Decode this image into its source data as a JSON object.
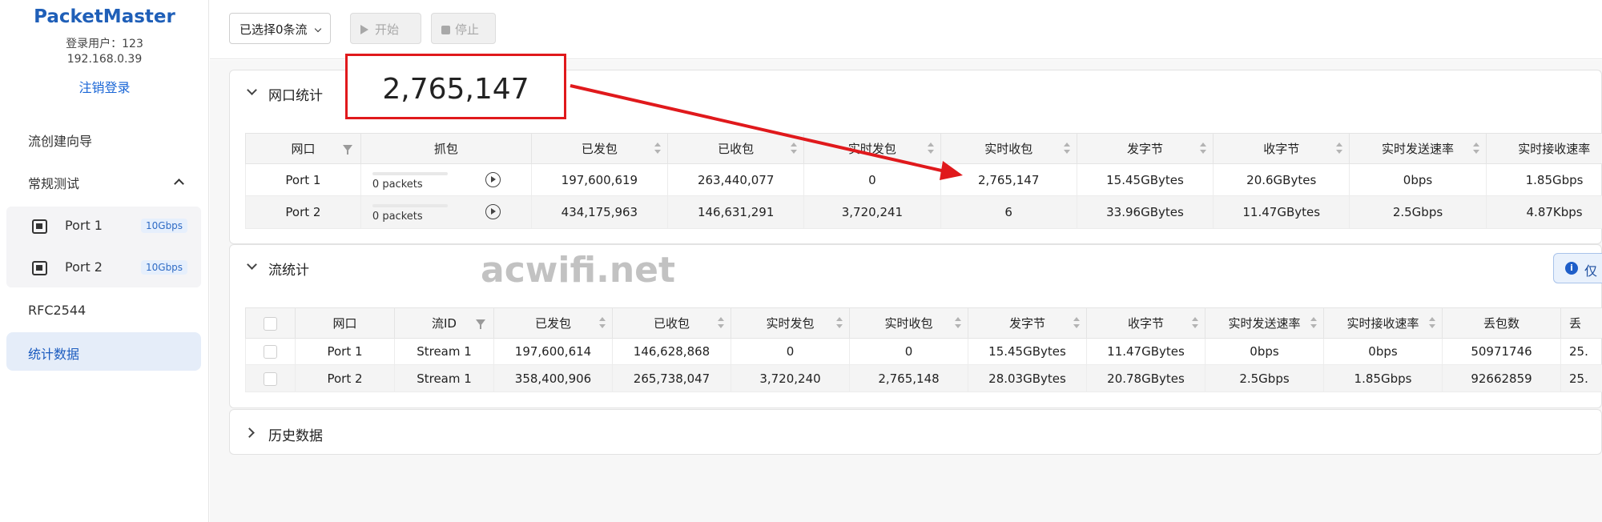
{
  "sidebar": {
    "brand": "PacketMaster",
    "user": "登录用户：123",
    "ip": "192.168.0.39",
    "logout": "注销登录",
    "items": [
      {
        "label": "流创建向导"
      },
      {
        "label": "常规测试"
      },
      {
        "label": "RFC2544"
      },
      {
        "label": "统计数据"
      }
    ],
    "ports": [
      {
        "label": "Port 1",
        "speed": "10Gbps"
      },
      {
        "label": "Port 2",
        "speed": "10Gbps"
      }
    ]
  },
  "toolbar": {
    "selector": "已选择0条流",
    "start": "开始",
    "stop": "停止"
  },
  "port_stats": {
    "title": "网口统计",
    "headers": [
      "网口",
      "抓包",
      "已发包",
      "已收包",
      "实时发包",
      "实时收包",
      "发字节",
      "收字节",
      "实时发送速率",
      "实时接收速率"
    ],
    "rows": [
      {
        "port": "Port 1",
        "capture": "0 packets",
        "sent": "197,600,619",
        "received": "263,440,077",
        "rt_sent": "0",
        "rt_recv": "2,765,147",
        "bytes_sent": "15.45GBytes",
        "bytes_recv": "20.6GBytes",
        "rate_tx": "0bps",
        "rate_rx": "1.85Gbps"
      },
      {
        "port": "Port 2",
        "capture": "0 packets",
        "sent": "434,175,963",
        "received": "146,631,291",
        "rt_sent": "3,720,241",
        "rt_recv": "6",
        "bytes_sent": "33.96GBytes",
        "bytes_recv": "11.47GBytes",
        "rate_tx": "2.5Gbps",
        "rate_rx": "4.87Kbps"
      }
    ]
  },
  "flow_stats": {
    "title": "流统计",
    "info_label": "仅",
    "headers": [
      "网口",
      "流ID",
      "已发包",
      "已收包",
      "实时发包",
      "实时收包",
      "发字节",
      "收字节",
      "实时发送速率",
      "实时接收速率",
      "丢包数",
      "丢"
    ],
    "rows": [
      {
        "port": "Port 1",
        "stream": "Stream 1",
        "sent": "197,600,614",
        "received": "146,628,868",
        "rt_sent": "0",
        "rt_recv": "0",
        "bytes_sent": "15.45GBytes",
        "bytes_recv": "11.47GBytes",
        "rate_tx": "0bps",
        "rate_rx": "0bps",
        "lost": "50971746",
        "loss": "25."
      },
      {
        "port": "Port 2",
        "stream": "Stream 1",
        "sent": "358,400,906",
        "received": "265,738,047",
        "rt_sent": "3,720,240",
        "rt_recv": "2,765,148",
        "bytes_sent": "28.03GBytes",
        "bytes_recv": "20.78GBytes",
        "rate_tx": "2.5Gbps",
        "rate_rx": "1.85Gbps",
        "lost": "92662859",
        "loss": "25."
      }
    ]
  },
  "history": {
    "title": "历史数据"
  },
  "watermark": "acwifi.net",
  "callout": {
    "value": "2,765,147"
  },
  "colors": {
    "accent": "#1f5fb8",
    "annotation": "#e0191c",
    "active_nav": "#e5edf9"
  }
}
